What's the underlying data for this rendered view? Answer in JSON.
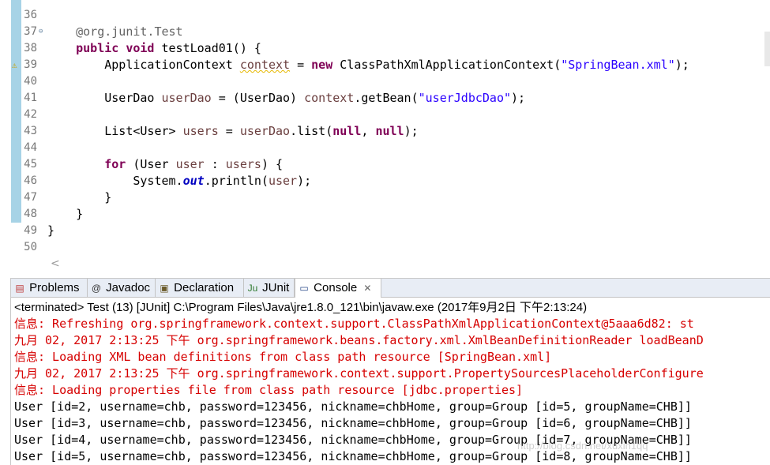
{
  "editor": {
    "line_numbers": [
      "36",
      "37",
      "38",
      "39",
      "40",
      "41",
      "42",
      "43",
      "44",
      "45",
      "46",
      "47",
      "48",
      "49",
      "50"
    ],
    "lines": [
      [],
      [
        {
          "t": "    "
        },
        {
          "t": "@org.junit.",
          "c": "ann"
        },
        {
          "t": "Test",
          "c": "ann"
        }
      ],
      [
        {
          "t": "    "
        },
        {
          "t": "public",
          "c": "kw"
        },
        {
          "t": " "
        },
        {
          "t": "void",
          "c": "kw"
        },
        {
          "t": " testLoad01() {"
        }
      ],
      [
        {
          "t": "        ApplicationContext "
        },
        {
          "t": "context",
          "c": "var squig"
        },
        {
          "t": " = "
        },
        {
          "t": "new",
          "c": "kw"
        },
        {
          "t": " ClassPathXmlApplicationContext("
        },
        {
          "t": "\"SpringBean.xml\"",
          "c": "str"
        },
        {
          "t": ");"
        }
      ],
      [],
      [
        {
          "t": "        UserDao "
        },
        {
          "t": "userDao",
          "c": "var"
        },
        {
          "t": " = (UserDao) "
        },
        {
          "t": "context",
          "c": "var"
        },
        {
          "t": ".getBean("
        },
        {
          "t": "\"userJdbcDao\"",
          "c": "str"
        },
        {
          "t": ");"
        }
      ],
      [],
      [
        {
          "t": "        List<User> "
        },
        {
          "t": "users",
          "c": "var"
        },
        {
          "t": " = "
        },
        {
          "t": "userDao",
          "c": "var"
        },
        {
          "t": ".list("
        },
        {
          "t": "null",
          "c": "kw"
        },
        {
          "t": ", "
        },
        {
          "t": "null",
          "c": "kw"
        },
        {
          "t": ");"
        }
      ],
      [],
      [
        {
          "t": "        "
        },
        {
          "t": "for",
          "c": "kw"
        },
        {
          "t": " (User "
        },
        {
          "t": "user",
          "c": "var"
        },
        {
          "t": " : "
        },
        {
          "t": "users",
          "c": "var"
        },
        {
          "t": ") {"
        }
      ],
      [
        {
          "t": "            System."
        },
        {
          "t": "out",
          "c": "fld"
        },
        {
          "t": ".println("
        },
        {
          "t": "user",
          "c": "var"
        },
        {
          "t": ");"
        }
      ],
      [
        {
          "t": "        }"
        }
      ],
      [
        {
          "t": "    }"
        }
      ],
      [
        {
          "t": "}"
        }
      ],
      []
    ]
  },
  "tabs": {
    "problems": "Problems",
    "javadoc": "Javadoc",
    "declaration": "Declaration",
    "junit": "JUnit",
    "console": "Console"
  },
  "console": {
    "terminated": "<terminated> Test (13) [JUnit] C:\\Program Files\\Java\\jre1.8.0_121\\bin\\javaw.exe (2017年9月2日 下午2:13:24)",
    "lines": [
      {
        "text": "信息: Refreshing org.springframework.context.support.ClassPathXmlApplicationContext@5aaa6d82: st",
        "color": "red"
      },
      {
        "text": "九月 02, 2017 2:13:25 下午 org.springframework.beans.factory.xml.XmlBeanDefinitionReader loadBeanD",
        "color": "red"
      },
      {
        "text": "信息: Loading XML bean definitions from class path resource [SpringBean.xml]",
        "color": "red"
      },
      {
        "text": "九月 02, 2017 2:13:25 下午 org.springframework.context.support.PropertySourcesPlaceholderConfigure",
        "color": "red"
      },
      {
        "text": "信息: Loading properties file from class path resource [jdbc.properties]",
        "color": "red"
      },
      {
        "text": "User [id=2, username=chb, password=123456, nickname=chbHome, group=Group [id=5, groupName=CHB]]",
        "color": "black"
      },
      {
        "text": "User [id=3, username=chb, password=123456, nickname=chbHome, group=Group [id=6, groupName=CHB]]",
        "color": "black"
      },
      {
        "text": "User [id=4, username=chb, password=123456, nickname=chbHome, group=Group [id=7, groupName=CHB]]",
        "color": "black"
      },
      {
        "text": "User [id=5, username=chb, password=123456, nickname=chbHome, group=Group [id=8, groupName=CHB]]",
        "color": "black"
      }
    ]
  },
  "watermark": "http://blog.csdn.net/xuxin1qq",
  "colors": {
    "keyword": "#7f0055",
    "string": "#2a00ff",
    "variable": "#6a3e3e",
    "field": "#0000c0",
    "console_red": "#d60000",
    "change_bar": "#a7d3e6"
  }
}
